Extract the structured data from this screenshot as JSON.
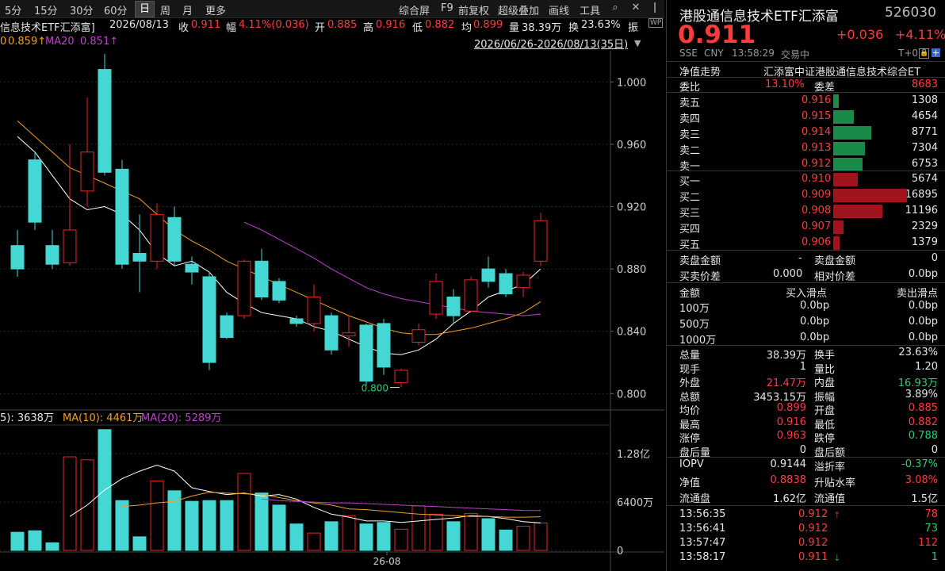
{
  "toolbar": {
    "periods": [
      "5分",
      "15分",
      "30分",
      "60分",
      "日",
      "周",
      "月",
      "更多"
    ],
    "active_period": "日",
    "right_items": [
      "综合屏",
      "F9",
      "前复权",
      "超级叠加",
      "画线",
      "工具"
    ]
  },
  "info": {
    "name": "信息技术ETF汇添富]",
    "date": "2026/08/13",
    "close_label": "收",
    "close": "0.911",
    "amp_label": "幅",
    "amp": "4.11%(0.036)",
    "open_label": "开",
    "open": "0.885",
    "high_label": "高",
    "high": "0.916",
    "low_label": "低",
    "low": "0.882",
    "avg_label": "均",
    "avg": "0.899",
    "vol_label": "量",
    "vol": "38.39万",
    "turn_label": "换",
    "turn": "23.63%",
    "more": "振"
  },
  "ma_line": {
    "ma10_value": "0.859↑",
    "ma20_label": "MA20",
    "ma20_value": "0.851↑",
    "range": "2026/06/26-2026/08/13(35日)"
  },
  "vol_line": {
    "vol5": "5): 3638万",
    "ma10": "MA(10): 4461万",
    "ma20": "MA(20): 5289万"
  },
  "chart_data": {
    "type": "candlestick",
    "price_ticks": [
      "1.000",
      "0.960",
      "0.920",
      "0.880",
      "0.840",
      "0.800"
    ],
    "price_tick_values": [
      1.0,
      0.96,
      0.92,
      0.88,
      0.84,
      0.8
    ],
    "ylim": [
      0.79,
      1.02
    ],
    "low_annotation": "0.800",
    "volume_ticks": [
      "1.28亿",
      "6400万",
      "0"
    ],
    "volume_tick_values": [
      12800,
      6400,
      0
    ],
    "x_label": "26-08",
    "candles": [
      {
        "o": 0.895,
        "h": 0.905,
        "l": 0.875,
        "c": 0.88,
        "v": 2400
      },
      {
        "o": 0.95,
        "h": 0.955,
        "l": 0.905,
        "c": 0.91,
        "v": 2600
      },
      {
        "o": 0.895,
        "h": 0.905,
        "l": 0.88,
        "c": 0.883,
        "v": 1000
      },
      {
        "o": 0.884,
        "h": 0.96,
        "l": 0.882,
        "c": 0.905,
        "v": 12400
      },
      {
        "o": 0.93,
        "h": 0.99,
        "l": 0.92,
        "c": 0.955,
        "v": 12000
      },
      {
        "o": 1.008,
        "h": 1.018,
        "l": 0.94,
        "c": 0.942,
        "v": 16000
      },
      {
        "o": 0.944,
        "h": 0.95,
        "l": 0.88,
        "c": 0.883,
        "v": 6600
      },
      {
        "o": 0.89,
        "h": 0.915,
        "l": 0.865,
        "c": 0.885,
        "v": 1800
      },
      {
        "o": 0.885,
        "h": 0.922,
        "l": 0.88,
        "c": 0.915,
        "v": 9200
      },
      {
        "o": 0.913,
        "h": 0.92,
        "l": 0.882,
        "c": 0.885,
        "v": 7900
      },
      {
        "o": 0.883,
        "h": 0.888,
        "l": 0.87,
        "c": 0.878,
        "v": 6500
      },
      {
        "o": 0.875,
        "h": 0.878,
        "l": 0.815,
        "c": 0.82,
        "v": 6600
      },
      {
        "o": 0.85,
        "h": 0.852,
        "l": 0.835,
        "c": 0.836,
        "v": 6600
      },
      {
        "o": 0.85,
        "h": 0.886,
        "l": 0.848,
        "c": 0.885,
        "v": 10200
      },
      {
        "o": 0.885,
        "h": 0.893,
        "l": 0.86,
        "c": 0.862,
        "v": 7600
      },
      {
        "o": 0.872,
        "h": 0.874,
        "l": 0.858,
        "c": 0.86,
        "v": 6000
      },
      {
        "o": 0.848,
        "h": 0.85,
        "l": 0.843,
        "c": 0.845,
        "v": 3500
      },
      {
        "o": 0.845,
        "h": 0.87,
        "l": 0.84,
        "c": 0.862,
        "v": 2300
      },
      {
        "o": 0.85,
        "h": 0.852,
        "l": 0.825,
        "c": 0.828,
        "v": 3800
      },
      {
        "o": 0.837,
        "h": 0.85,
        "l": 0.83,
        "c": 0.839,
        "v": 4600
      },
      {
        "o": 0.844,
        "h": 0.845,
        "l": 0.805,
        "c": 0.808,
        "v": 3500
      },
      {
        "o": 0.845,
        "h": 0.848,
        "l": 0.812,
        "c": 0.817,
        "v": 3700
      },
      {
        "o": 0.807,
        "h": 0.816,
        "l": 0.804,
        "c": 0.815,
        "v": 2800
      },
      {
        "o": 0.833,
        "h": 0.845,
        "l": 0.831,
        "c": 0.841,
        "v": 5900
      },
      {
        "o": 0.851,
        "h": 0.877,
        "l": 0.848,
        "c": 0.872,
        "v": 4800
      },
      {
        "o": 0.862,
        "h": 0.867,
        "l": 0.845,
        "c": 0.85,
        "v": 3800
      },
      {
        "o": 0.853,
        "h": 0.875,
        "l": 0.852,
        "c": 0.873,
        "v": 4900
      },
      {
        "o": 0.88,
        "h": 0.888,
        "l": 0.868,
        "c": 0.872,
        "v": 4200
      },
      {
        "o": 0.877,
        "h": 0.88,
        "l": 0.862,
        "c": 0.864,
        "v": 2700
      },
      {
        "o": 0.868,
        "h": 0.878,
        "l": 0.862,
        "c": 0.876,
        "v": 3200
      },
      {
        "o": 0.885,
        "h": 0.916,
        "l": 0.882,
        "c": 0.911,
        "v": 3640
      }
    ],
    "ma_price": [
      {
        "name": "MA5",
        "color": "#ffffff",
        "values": [
          0.965,
          0.955,
          0.94,
          0.925,
          0.918,
          0.92,
          0.915,
          0.905,
          0.89,
          0.882,
          0.885,
          0.878,
          0.865,
          0.858,
          0.852,
          0.85,
          0.848,
          0.843,
          0.84,
          0.835,
          0.83,
          0.826,
          0.825,
          0.828,
          0.835,
          0.845,
          0.853,
          0.862,
          0.866,
          0.87,
          0.88
        ]
      },
      {
        "name": "MA10",
        "color": "#f0a020",
        "values": [
          0.975,
          0.965,
          0.955,
          0.945,
          0.94,
          0.935,
          0.93,
          0.925,
          0.915,
          0.905,
          0.898,
          0.892,
          0.885,
          0.88,
          0.875,
          0.87,
          0.865,
          0.86,
          0.855,
          0.85,
          0.846,
          0.842,
          0.839,
          0.838,
          0.838,
          0.84,
          0.842,
          0.845,
          0.848,
          0.852,
          0.859
        ]
      },
      {
        "name": "MA20",
        "color": "#c040d0",
        "values": [
          null,
          null,
          null,
          null,
          null,
          null,
          null,
          null,
          null,
          null,
          null,
          null,
          null,
          0.91,
          0.905,
          0.899,
          0.893,
          0.887,
          0.88,
          0.874,
          0.868,
          0.864,
          0.861,
          0.859,
          0.857,
          0.855,
          0.853,
          0.852,
          0.851,
          0.85,
          0.851
        ]
      }
    ],
    "ma_volume": [
      {
        "name": "MA5",
        "color": "#ffffff",
        "values": [
          null,
          null,
          null,
          4500,
          6000,
          8000,
          9500,
          10500,
          11300,
          10500,
          8300,
          7800,
          7400,
          7600,
          7200,
          7400,
          6800,
          5700,
          4800,
          4400,
          3900,
          3900,
          3700,
          3900,
          4100,
          4300,
          4600,
          4500,
          4200,
          3800,
          3640
        ]
      },
      {
        "name": "MA10",
        "color": "#f0a020",
        "values": [
          null,
          null,
          null,
          null,
          null,
          null,
          5800,
          6000,
          6300,
          6500,
          7200,
          7700,
          7600,
          7500,
          7400,
          7000,
          6600,
          6300,
          6000,
          5500,
          5400,
          5200,
          5000,
          4800,
          4700,
          4600,
          4500,
          4500,
          4400,
          4400,
          4461
        ]
      },
      {
        "name": "MA20",
        "color": "#c040d0",
        "values": [
          null,
          null,
          null,
          null,
          null,
          null,
          null,
          null,
          null,
          null,
          null,
          null,
          null,
          null,
          6800,
          6600,
          6500,
          6400,
          6300,
          6300,
          6200,
          6100,
          6000,
          5900,
          5800,
          5700,
          5600,
          5500,
          5400,
          5300,
          5289
        ]
      }
    ]
  },
  "panel": {
    "title": "港股通信息技术ETF汇添富",
    "code": "526030",
    "price": "0.911",
    "change": "+0.036",
    "change_pct": "+4.11%",
    "market": "SSE",
    "currency": "CNY",
    "time": "13:58:29",
    "status": "交易中",
    "t0": "T+0",
    "trend_label": "净值走势",
    "index_name": "汇添富中证港股通信息技术综合ET",
    "commission_ratio_label": "委比",
    "commission_ratio": "13.10%",
    "commission_diff_label": "委差",
    "commission_diff": "8683",
    "asks": [
      {
        "label": "卖五",
        "price": "0.916",
        "qty": "1308",
        "vol": 1308
      },
      {
        "label": "卖四",
        "price": "0.915",
        "qty": "4654",
        "vol": 4654
      },
      {
        "label": "卖三",
        "price": "0.914",
        "qty": "8771",
        "vol": 8771
      },
      {
        "label": "卖二",
        "price": "0.913",
        "qty": "7304",
        "vol": 7304
      },
      {
        "label": "卖一",
        "price": "0.912",
        "qty": "6753",
        "vol": 6753
      }
    ],
    "bids": [
      {
        "label": "买一",
        "price": "0.910",
        "qty": "5674",
        "vol": 5674
      },
      {
        "label": "买二",
        "price": "0.909",
        "qty": "16895",
        "vol": 16895
      },
      {
        "label": "买三",
        "price": "0.908",
        "qty": "11196",
        "vol": 11196
      },
      {
        "label": "买四",
        "price": "0.907",
        "qty": "2329",
        "vol": 2329
      },
      {
        "label": "买五",
        "price": "0.906",
        "qty": "1379",
        "vol": 1379
      }
    ],
    "sell_amount_label": "卖盘金额",
    "sell_amount": "-",
    "sell_amount_label2": "卖盘金额",
    "sell_amount2": "0",
    "spread_label": "买卖价差",
    "spread": "0.000",
    "rel_spread_label": "相对价差",
    "rel_spread": "0.0bp",
    "slip_header": [
      "金额",
      "买入滑点",
      "卖出滑点"
    ],
    "slips": [
      {
        "amount": "100万",
        "buy": "0.0bp",
        "sell": "0.0bp"
      },
      {
        "amount": "500万",
        "buy": "0.0bp",
        "sell": "0.0bp"
      },
      {
        "amount": "1000万",
        "buy": "0.0bp",
        "sell": "0.0bp"
      }
    ],
    "stats": [
      {
        "l": "总量",
        "v": "38.39万",
        "vc": "white",
        "l2": "换手",
        "v2": "23.63%",
        "v2c": "white"
      },
      {
        "l": "现手",
        "v": "1",
        "vc": "white",
        "l2": "量比",
        "v2": "1.20",
        "v2c": "white"
      },
      {
        "l": "外盘",
        "v": "21.47万",
        "vc": "red",
        "l2": "内盘",
        "v2": "16.93万",
        "v2c": "green"
      },
      {
        "l": "总额",
        "v": "3453.15万",
        "vc": "white",
        "l2": "振幅",
        "v2": "3.89%",
        "v2c": "white"
      },
      {
        "l": "均价",
        "v": "0.899",
        "vc": "red",
        "l2": "开盘",
        "v2": "0.885",
        "v2c": "red"
      },
      {
        "l": "最高",
        "v": "0.916",
        "vc": "red",
        "l2": "最低",
        "v2": "0.882",
        "v2c": "red"
      },
      {
        "l": "涨停",
        "v": "0.963",
        "vc": "red",
        "l2": "跌停",
        "v2": "0.788",
        "v2c": "green"
      },
      {
        "l": "盘后量",
        "v": "0",
        "vc": "white",
        "l2": "盘后额",
        "v2": "0",
        "v2c": "white"
      }
    ],
    "stats2": [
      {
        "l": "IOPV",
        "v": "0.9144",
        "vc": "white",
        "l2": "溢折率",
        "v2": "-0.37%",
        "v2c": "green"
      },
      {
        "l": "净值",
        "v": "0.8838",
        "vc": "red",
        "l2": "升贴水率",
        "v2": "3.08%",
        "v2c": "red"
      },
      {
        "l": "流通盘",
        "v": "1.62亿",
        "vc": "white",
        "l2": "流通值",
        "v2": "1.5亿",
        "v2c": "white"
      }
    ],
    "ticks": [
      {
        "time": "13:56:35",
        "price": "0.912",
        "arrow": "up",
        "vol": "78",
        "vc": "red"
      },
      {
        "time": "13:56:41",
        "price": "0.912",
        "arrow": "",
        "vol": "73",
        "vc": "green"
      },
      {
        "time": "13:57:47",
        "price": "0.912",
        "arrow": "",
        "vol": "112",
        "vc": "red"
      },
      {
        "time": "13:58:17",
        "price": "0.911",
        "arrow": "down",
        "vol": "1",
        "vc": "green"
      }
    ]
  }
}
